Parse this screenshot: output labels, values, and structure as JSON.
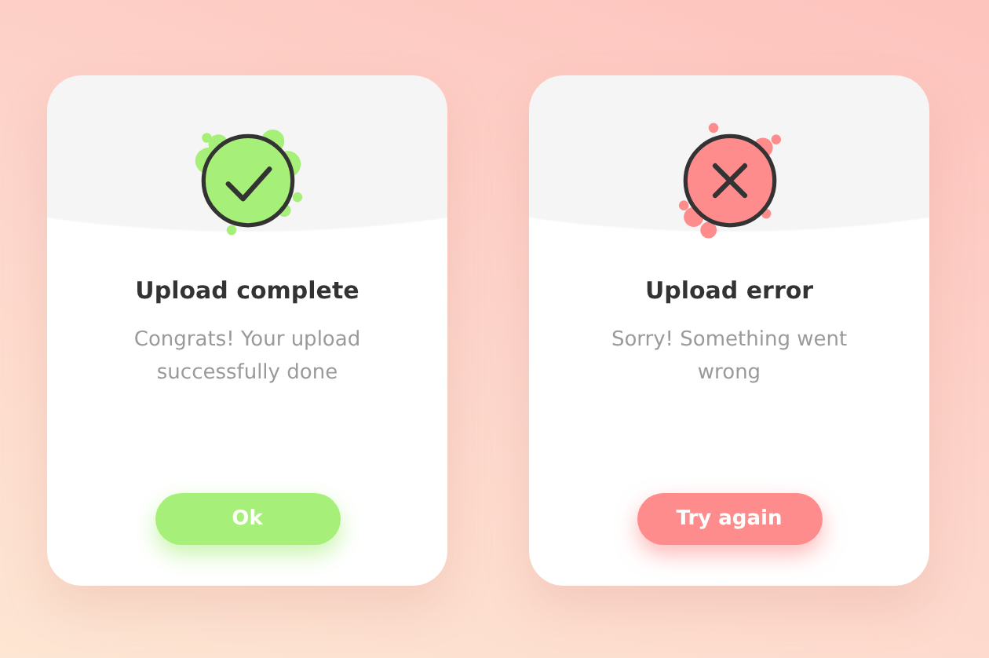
{
  "cards": [
    {
      "kind": "success",
      "color": "#a6ef78",
      "title": "Upload complete",
      "message": "Congrats! Your upload successfully done",
      "button": "Ok"
    },
    {
      "kind": "error",
      "color": "#ff8c8c",
      "title": "Upload error",
      "message": "Sorry! Something went wrong",
      "button": "Try again"
    }
  ]
}
